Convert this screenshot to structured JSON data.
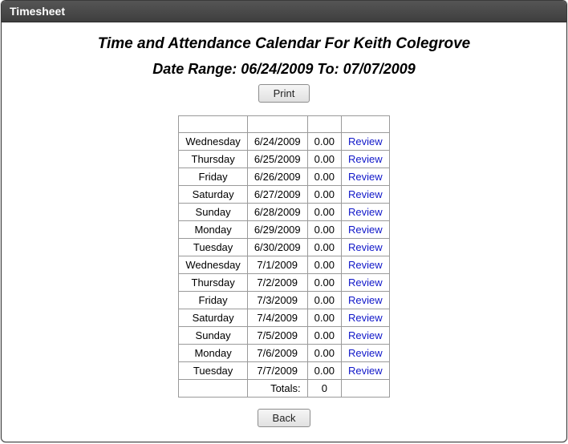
{
  "window": {
    "title": "Timesheet"
  },
  "headings": {
    "main": "Time and Attendance Calendar For Keith Colegrove",
    "range": "Date Range: 06/24/2009 To: 07/07/2009"
  },
  "buttons": {
    "print": "Print",
    "back": "Back"
  },
  "links": {
    "review": "Review"
  },
  "table": {
    "rows": [
      {
        "day": "Wednesday",
        "date": "6/24/2009",
        "hours": "0.00"
      },
      {
        "day": "Thursday",
        "date": "6/25/2009",
        "hours": "0.00"
      },
      {
        "day": "Friday",
        "date": "6/26/2009",
        "hours": "0.00"
      },
      {
        "day": "Saturday",
        "date": "6/27/2009",
        "hours": "0.00"
      },
      {
        "day": "Sunday",
        "date": "6/28/2009",
        "hours": "0.00"
      },
      {
        "day": "Monday",
        "date": "6/29/2009",
        "hours": "0.00"
      },
      {
        "day": "Tuesday",
        "date": "6/30/2009",
        "hours": "0.00"
      },
      {
        "day": "Wednesday",
        "date": "7/1/2009",
        "hours": "0.00"
      },
      {
        "day": "Thursday",
        "date": "7/2/2009",
        "hours": "0.00"
      },
      {
        "day": "Friday",
        "date": "7/3/2009",
        "hours": "0.00"
      },
      {
        "day": "Saturday",
        "date": "7/4/2009",
        "hours": "0.00"
      },
      {
        "day": "Sunday",
        "date": "7/5/2009",
        "hours": "0.00"
      },
      {
        "day": "Monday",
        "date": "7/6/2009",
        "hours": "0.00"
      },
      {
        "day": "Tuesday",
        "date": "7/7/2009",
        "hours": "0.00"
      }
    ],
    "totals": {
      "label": "Totals:",
      "value": "0"
    }
  }
}
